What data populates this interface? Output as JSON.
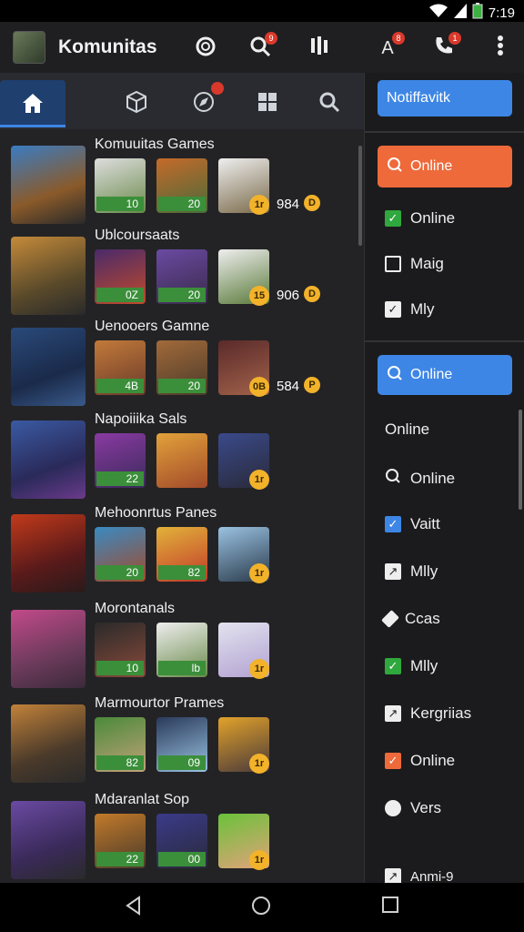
{
  "status": {
    "time": "7:19"
  },
  "appbar": {
    "title": "Komunitas",
    "badge1": "9",
    "badge2": "8",
    "badge3": "1"
  },
  "rows": [
    {
      "title": "Komuuitas Games",
      "tiles": [
        "10",
        "20"
      ],
      "score": "984",
      "coin": "D",
      "coinTile": "1r"
    },
    {
      "title": "Ublcoursaats",
      "tiles": [
        "0Z",
        "20"
      ],
      "score": "906",
      "coin": "D",
      "coinTile": "15"
    },
    {
      "title": "Uenooers Gamne",
      "tiles": [
        "4B",
        "20"
      ],
      "score": "584",
      "coin": "P",
      "coinTile": "0B"
    },
    {
      "title": "Napoiiika Sals",
      "tiles": [
        "22",
        ""
      ],
      "score": "",
      "coin": "",
      "coinTile": "1r"
    },
    {
      "title": "Mehoonrtus Panes",
      "tiles": [
        "20",
        "82"
      ],
      "score": "",
      "coin": "",
      "coinTile": "1r"
    },
    {
      "title": "Morontanals",
      "tiles": [
        "10",
        "lb"
      ],
      "score": "",
      "coin": "",
      "coinTile": "1r"
    },
    {
      "title": "Marmourtor Prames",
      "tiles": [
        "82",
        "09"
      ],
      "score": "",
      "coin": "",
      "coinTile": "1r"
    },
    {
      "title": "Mdaranlat Sop",
      "tiles": [
        "22",
        "00"
      ],
      "score": "",
      "coin": "",
      "coinTile": "1r"
    }
  ],
  "right": {
    "notif": "Notiffavitk",
    "online1": "Online",
    "item1": "Online",
    "item2": "Maig",
    "item3": "Mly",
    "online2": "Online",
    "list": [
      "Online",
      "Online",
      "Vaitt",
      "Mlly",
      "Ccas",
      "Mlly",
      "Kergriias",
      "Online",
      "Vers",
      "Anmi-9"
    ]
  },
  "colors": {
    "accent": "#3d86e5",
    "orange": "#ee6a3a",
    "green": "#2fa83d"
  }
}
